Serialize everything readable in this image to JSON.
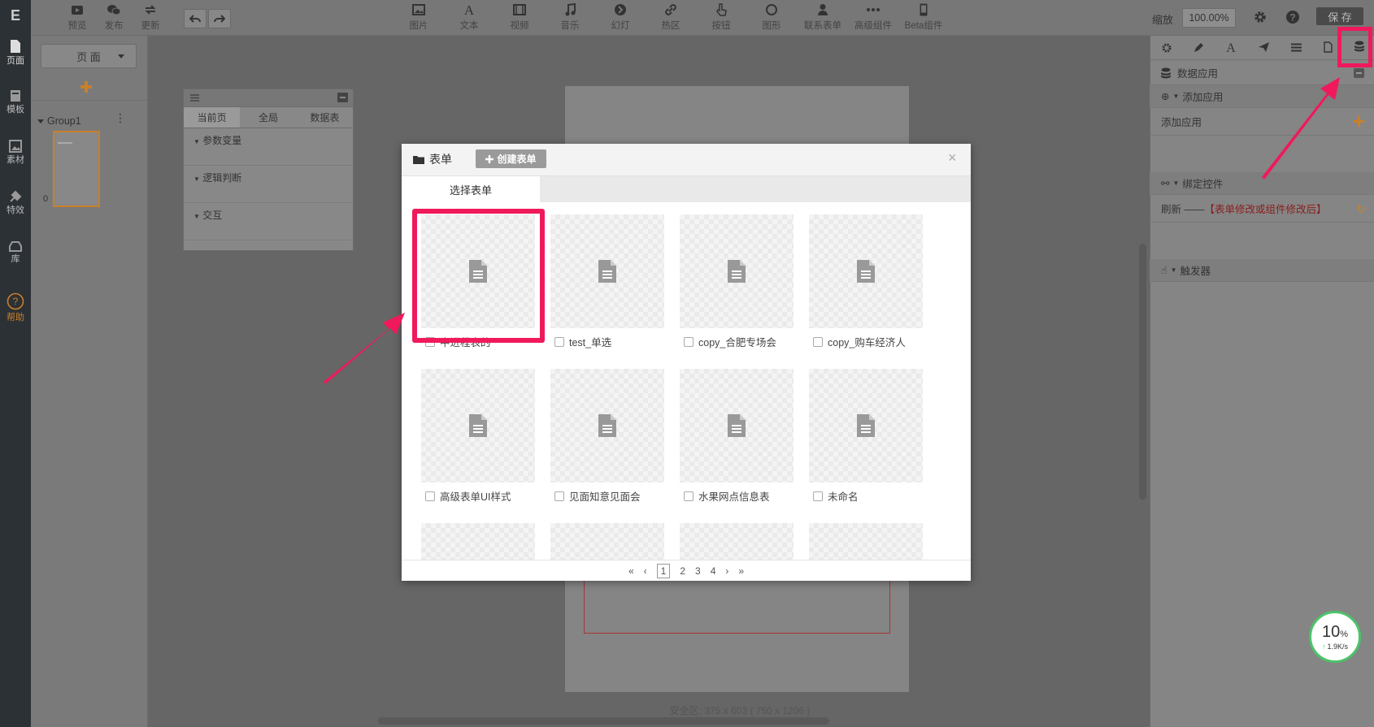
{
  "rail": {
    "logo": "E",
    "items": [
      {
        "label": "页面",
        "icon": "page-icon"
      },
      {
        "label": "模板",
        "icon": "template-icon"
      },
      {
        "label": "素材",
        "icon": "image-icon"
      },
      {
        "label": "特效",
        "icon": "effects-icon"
      },
      {
        "label": "库",
        "icon": "library-icon"
      },
      {
        "label": "帮助",
        "icon": "help-icon"
      }
    ]
  },
  "toolbar": {
    "left": [
      {
        "label": "预览",
        "icon": "preview-icon"
      },
      {
        "label": "发布",
        "icon": "wechat-icon"
      },
      {
        "label": "更新",
        "icon": "refresh-icon"
      }
    ],
    "center": [
      {
        "label": "图片",
        "icon": "image-icon"
      },
      {
        "label": "文本",
        "icon": "text-icon"
      },
      {
        "label": "视频",
        "icon": "video-icon"
      },
      {
        "label": "音乐",
        "icon": "music-icon"
      },
      {
        "label": "幻灯",
        "icon": "slideshow-icon"
      },
      {
        "label": "热区",
        "icon": "link-icon"
      },
      {
        "label": "按钮",
        "icon": "pointer-icon"
      },
      {
        "label": "图形",
        "icon": "circle-icon"
      },
      {
        "label": "联系表单",
        "icon": "user-icon"
      },
      {
        "label": "高级组件",
        "icon": "more-icon"
      },
      {
        "label": "Beta组件",
        "icon": "phone-icon"
      }
    ],
    "zoom_label": "缩放",
    "zoom_value": "100.00%",
    "save_label": "保 存"
  },
  "page_panel": {
    "select_label": "页 面",
    "group_name": "Group1",
    "page_index": "0"
  },
  "float_panel": {
    "tabs": [
      "当前页",
      "全局",
      "数据表"
    ],
    "sections": [
      "参数变量",
      "逻辑判断",
      "交互"
    ]
  },
  "canvas": {
    "safe_area": "安全区: 375 x 603 ( 750 x 1206 )"
  },
  "right_panel": {
    "data_app": "数据应用",
    "add_app_section": "添加应用",
    "add_app_row": "添加应用",
    "bind_section": "绑定控件",
    "refresh_prefix": "刷新 ——",
    "refresh_note": "【表单修改或组件修改后】",
    "trigger_section": "触发器"
  },
  "modal": {
    "title": "表单",
    "create_label": "创建表单",
    "close": "×",
    "tab": "选择表单",
    "forms": [
      "中进程表的",
      "test_单选",
      "copy_合肥专场会",
      "copy_购车经济人",
      "高级表单UI样式",
      "见面知意见面会",
      "水果网点信息表",
      "未命名"
    ],
    "pager": {
      "first": "«",
      "prev": "‹",
      "pages": [
        "1",
        "2",
        "3",
        "4"
      ],
      "current": "1",
      "next": "›",
      "last": "»"
    }
  },
  "network": {
    "percent": "10",
    "unit": "%",
    "speed": "1.9K/s"
  },
  "colors": {
    "highlight": "#f0195c",
    "accent": "#e8a23a"
  }
}
